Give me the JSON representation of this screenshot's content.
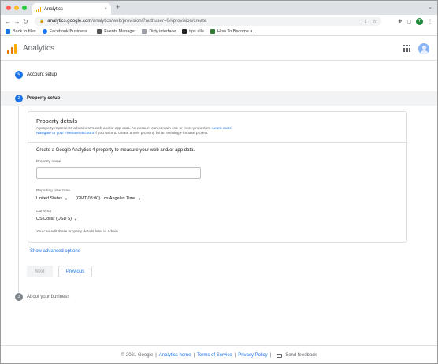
{
  "browser": {
    "tab_title": "Analytics",
    "tab_close": "×",
    "new_tab": "+",
    "url_host": "analytics.google.com",
    "url_path": "/analytics/web/provision/?authuser=0#/provision/create",
    "profile_initial": "T",
    "bookmarks": [
      {
        "label": "Back to files",
        "color": "#1a73e8"
      },
      {
        "label": "Facebook Business...",
        "color": "#1877f2"
      },
      {
        "label": "Events Manager",
        "color": "#555555"
      },
      {
        "label": "Dirty interface",
        "color": "#9aa0a6"
      },
      {
        "label": "tips alle",
        "color": "#222222"
      },
      {
        "label": "How To Become a...",
        "color": "#2e7d32"
      }
    ]
  },
  "app": {
    "title": "Analytics",
    "logo_colors": [
      "#f9ab00",
      "#e37400",
      "#e37400"
    ]
  },
  "steps": {
    "account": {
      "label": "Account setup",
      "icon": "pencil-icon"
    },
    "property": {
      "label": "Property setup",
      "number": "2"
    },
    "business": {
      "label": "About your business",
      "number": "3"
    }
  },
  "card": {
    "title": "Property details",
    "desc_1": "A property represents a business's web and/or app data. An account can contain one or more properties.",
    "learn_more": "Learn more",
    "navigate_link": "Navigate to your Firebase account",
    "desc_2": " if you want to create a new property for an existing Firebase project.",
    "prompt": "Create a Google Analytics 4 property to measure your web and/or app data.",
    "property_name_label": "Property name",
    "property_name_value": "",
    "timezone_label": "Reporting time zone",
    "country": "United States",
    "timezone": "(GMT-08:00) Los Angeles Time",
    "currency_label": "Currency",
    "currency": "US Dollar (USD $)",
    "hint": "You can edit these property details later in Admin"
  },
  "actions": {
    "show_advanced": "Show advanced options",
    "next": "Next",
    "previous": "Previous"
  },
  "footer": {
    "copyright": "© 2021 Google",
    "home": "Analytics home",
    "terms": "Terms of Service",
    "privacy": "Privacy Policy",
    "feedback": "Send feedback"
  }
}
